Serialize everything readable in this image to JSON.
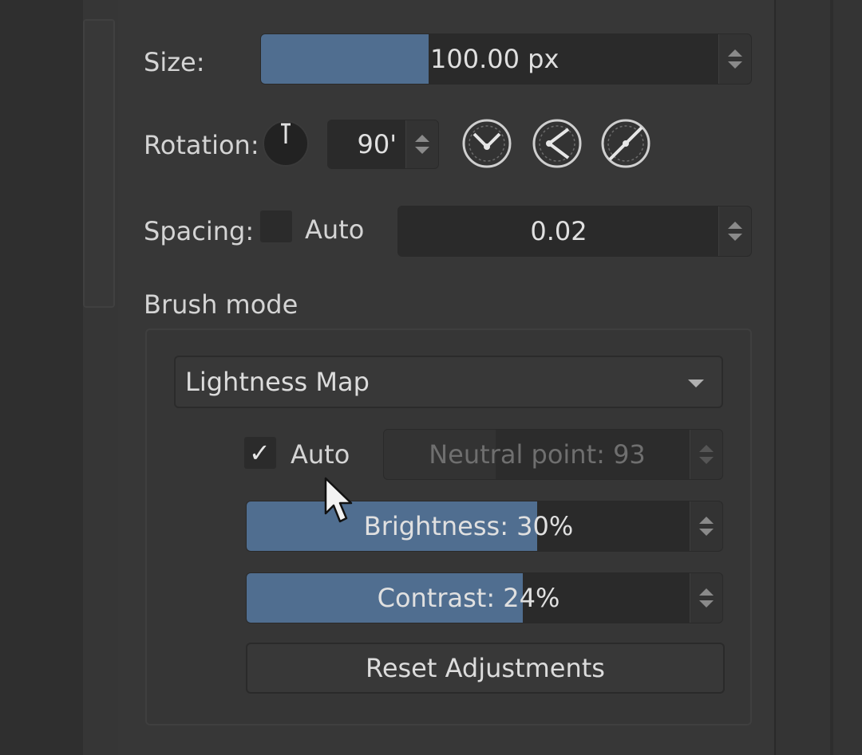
{
  "size": {
    "label": "Size:",
    "value": "100.00 px",
    "fill_fraction": 0.35
  },
  "rotation": {
    "label": "Rotation:",
    "value": "90'",
    "dial_icon": "rotation-dial-icon",
    "preset_icons": [
      "rotation-preset-1-icon",
      "rotation-preset-2-icon",
      "rotation-preset-3-icon"
    ]
  },
  "spacing": {
    "label": "Spacing:",
    "auto_label": "Auto",
    "auto_checked": false,
    "value": "0.02"
  },
  "brush_mode": {
    "section_label": "Brush mode",
    "mode_selected": "Lightness Map",
    "auto_label": "Auto",
    "auto_checked": true,
    "neutral_point": {
      "text": "Neutral point: 93",
      "disabled": true
    },
    "brightness": {
      "text": "Brightness: 30%",
      "fill_fraction": 0.65
    },
    "contrast": {
      "text": "Contrast: 24%",
      "fill_fraction": 0.62
    },
    "reset_label": "Reset Adjustments"
  },
  "colors": {
    "accent": "#506e90",
    "panel": "#373737",
    "field": "#2a2a2a"
  }
}
